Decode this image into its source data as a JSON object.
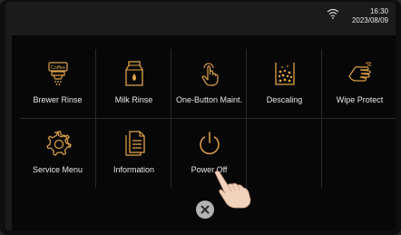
{
  "status": {
    "time": "16:30",
    "date": "2023/08/09",
    "wifi_icon": "wifi-icon"
  },
  "menu": {
    "accent_color": "#e0a44a",
    "items": [
      {
        "label": "Brewer Rinse",
        "icon": "coffee-brewer-icon"
      },
      {
        "label": "Milk Rinse",
        "icon": "milk-carton-icon"
      },
      {
        "label": "One-Button Maint.",
        "icon": "touch-finger-icon"
      },
      {
        "label": "Descaling",
        "icon": "descaling-container-icon"
      },
      {
        "label": "Wipe Protect",
        "icon": "wipe-hand-icon"
      },
      {
        "label": "Service Menu",
        "icon": "gear-icon"
      },
      {
        "label": "Information",
        "icon": "document-icon"
      },
      {
        "label": "Power Off",
        "icon": "power-icon"
      }
    ]
  },
  "close_icon": "close-icon"
}
